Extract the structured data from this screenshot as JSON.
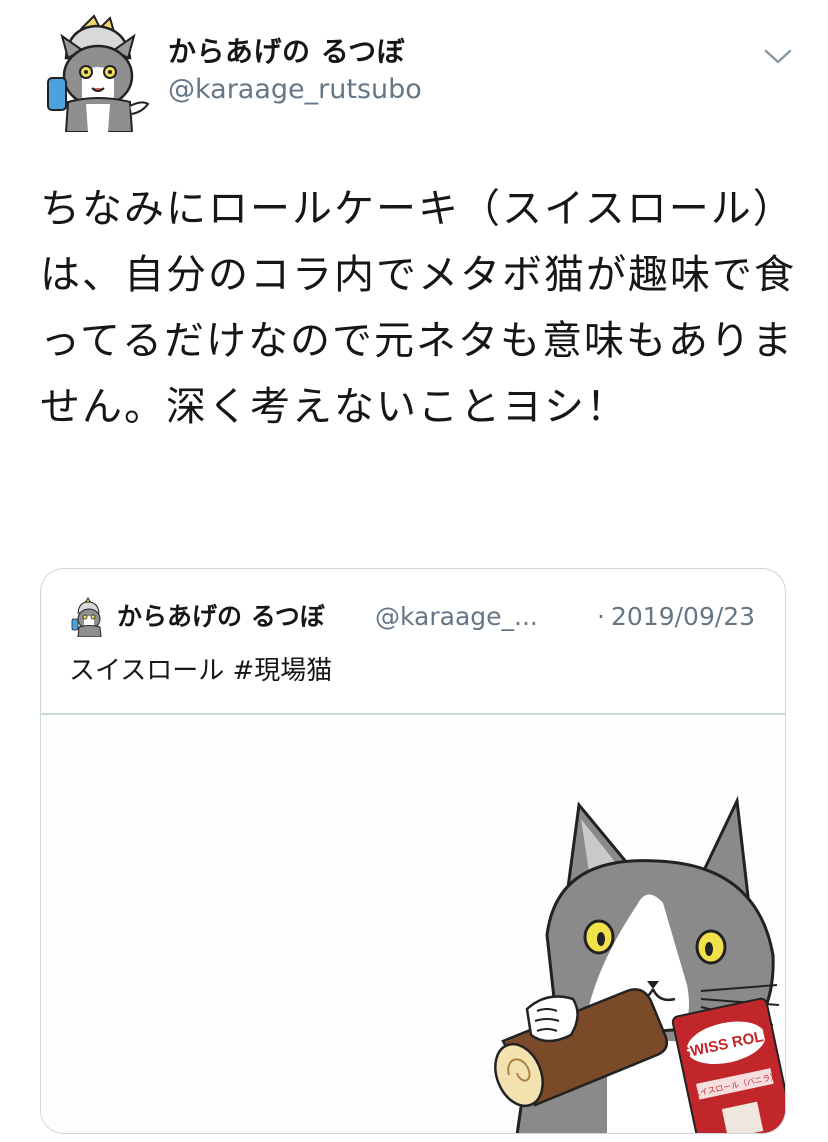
{
  "tweet": {
    "author": {
      "display_name": "からあげの るつぼ",
      "handle": "@karaage_rutsubo",
      "avatar_icon": "cat-worker-avatar-icon"
    },
    "menu_icon": "chevron-down-icon",
    "text": "ちなみにロールケーキ（スイスロール）は、自分のコラ内でメタボ猫が趣味で食ってるだけなので元ネタも意味もありません。深く考えないことヨシ！"
  },
  "quoted_tweet": {
    "author": {
      "display_name": "からあげの るつぼ",
      "handle": "@karaage_...",
      "avatar_icon": "cat-worker-avatar-icon"
    },
    "separator": "·",
    "date": "2019/09/23",
    "text": "スイスロール #現場猫",
    "media": {
      "description_icon": "cat-eating-swiss-roll-image",
      "package_text": "SWISS ROLL",
      "package_subtext": "スイスロール（バニラ）"
    }
  },
  "colors": {
    "text_primary": "#14171a",
    "text_secondary": "#657786",
    "border": "#ccd6dd"
  }
}
